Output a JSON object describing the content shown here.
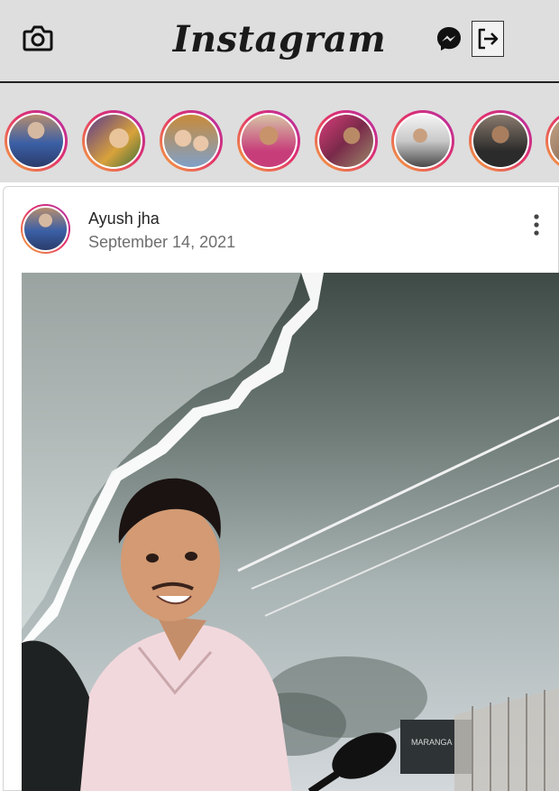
{
  "header": {
    "logo": "Instagram",
    "icons": {
      "camera": "camera-icon",
      "messenger": "messenger-icon",
      "logout": "logout-icon"
    }
  },
  "stories": [
    {
      "name": "story-1"
    },
    {
      "name": "story-2"
    },
    {
      "name": "story-3"
    },
    {
      "name": "story-4"
    },
    {
      "name": "story-5"
    },
    {
      "name": "story-6"
    },
    {
      "name": "story-7"
    },
    {
      "name": "story-8"
    }
  ],
  "post": {
    "username": "Ayush jha",
    "date": "September 14, 2021",
    "more_icon": "more-vertical-icon"
  },
  "colors": {
    "header_bg": "#dedede",
    "story_ring_start": "#f6a83a",
    "story_ring_mid": "#e1306c",
    "story_ring_end": "#b22fa8"
  }
}
